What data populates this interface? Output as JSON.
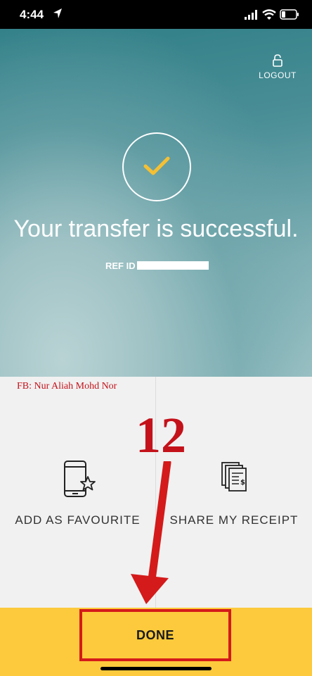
{
  "status_bar": {
    "time": "4:44"
  },
  "header": {
    "logout_label": "LOGOUT"
  },
  "hero": {
    "title": "Your transfer is successful.",
    "ref_label": "REF ID"
  },
  "actions": [
    {
      "label": "ADD AS FAVOURITE",
      "icon": "phone-star-icon"
    },
    {
      "label": "SHARE MY RECEIPT",
      "icon": "receipt-icon"
    }
  ],
  "annotation": {
    "watermark": "FB: Nur Aliah Mohd Nor",
    "step": "12"
  },
  "footer": {
    "done_label": "DONE"
  },
  "colors": {
    "accent_yellow": "#fcca3c",
    "check_yellow": "#f5c033",
    "annotation_red": "#c4121a"
  }
}
